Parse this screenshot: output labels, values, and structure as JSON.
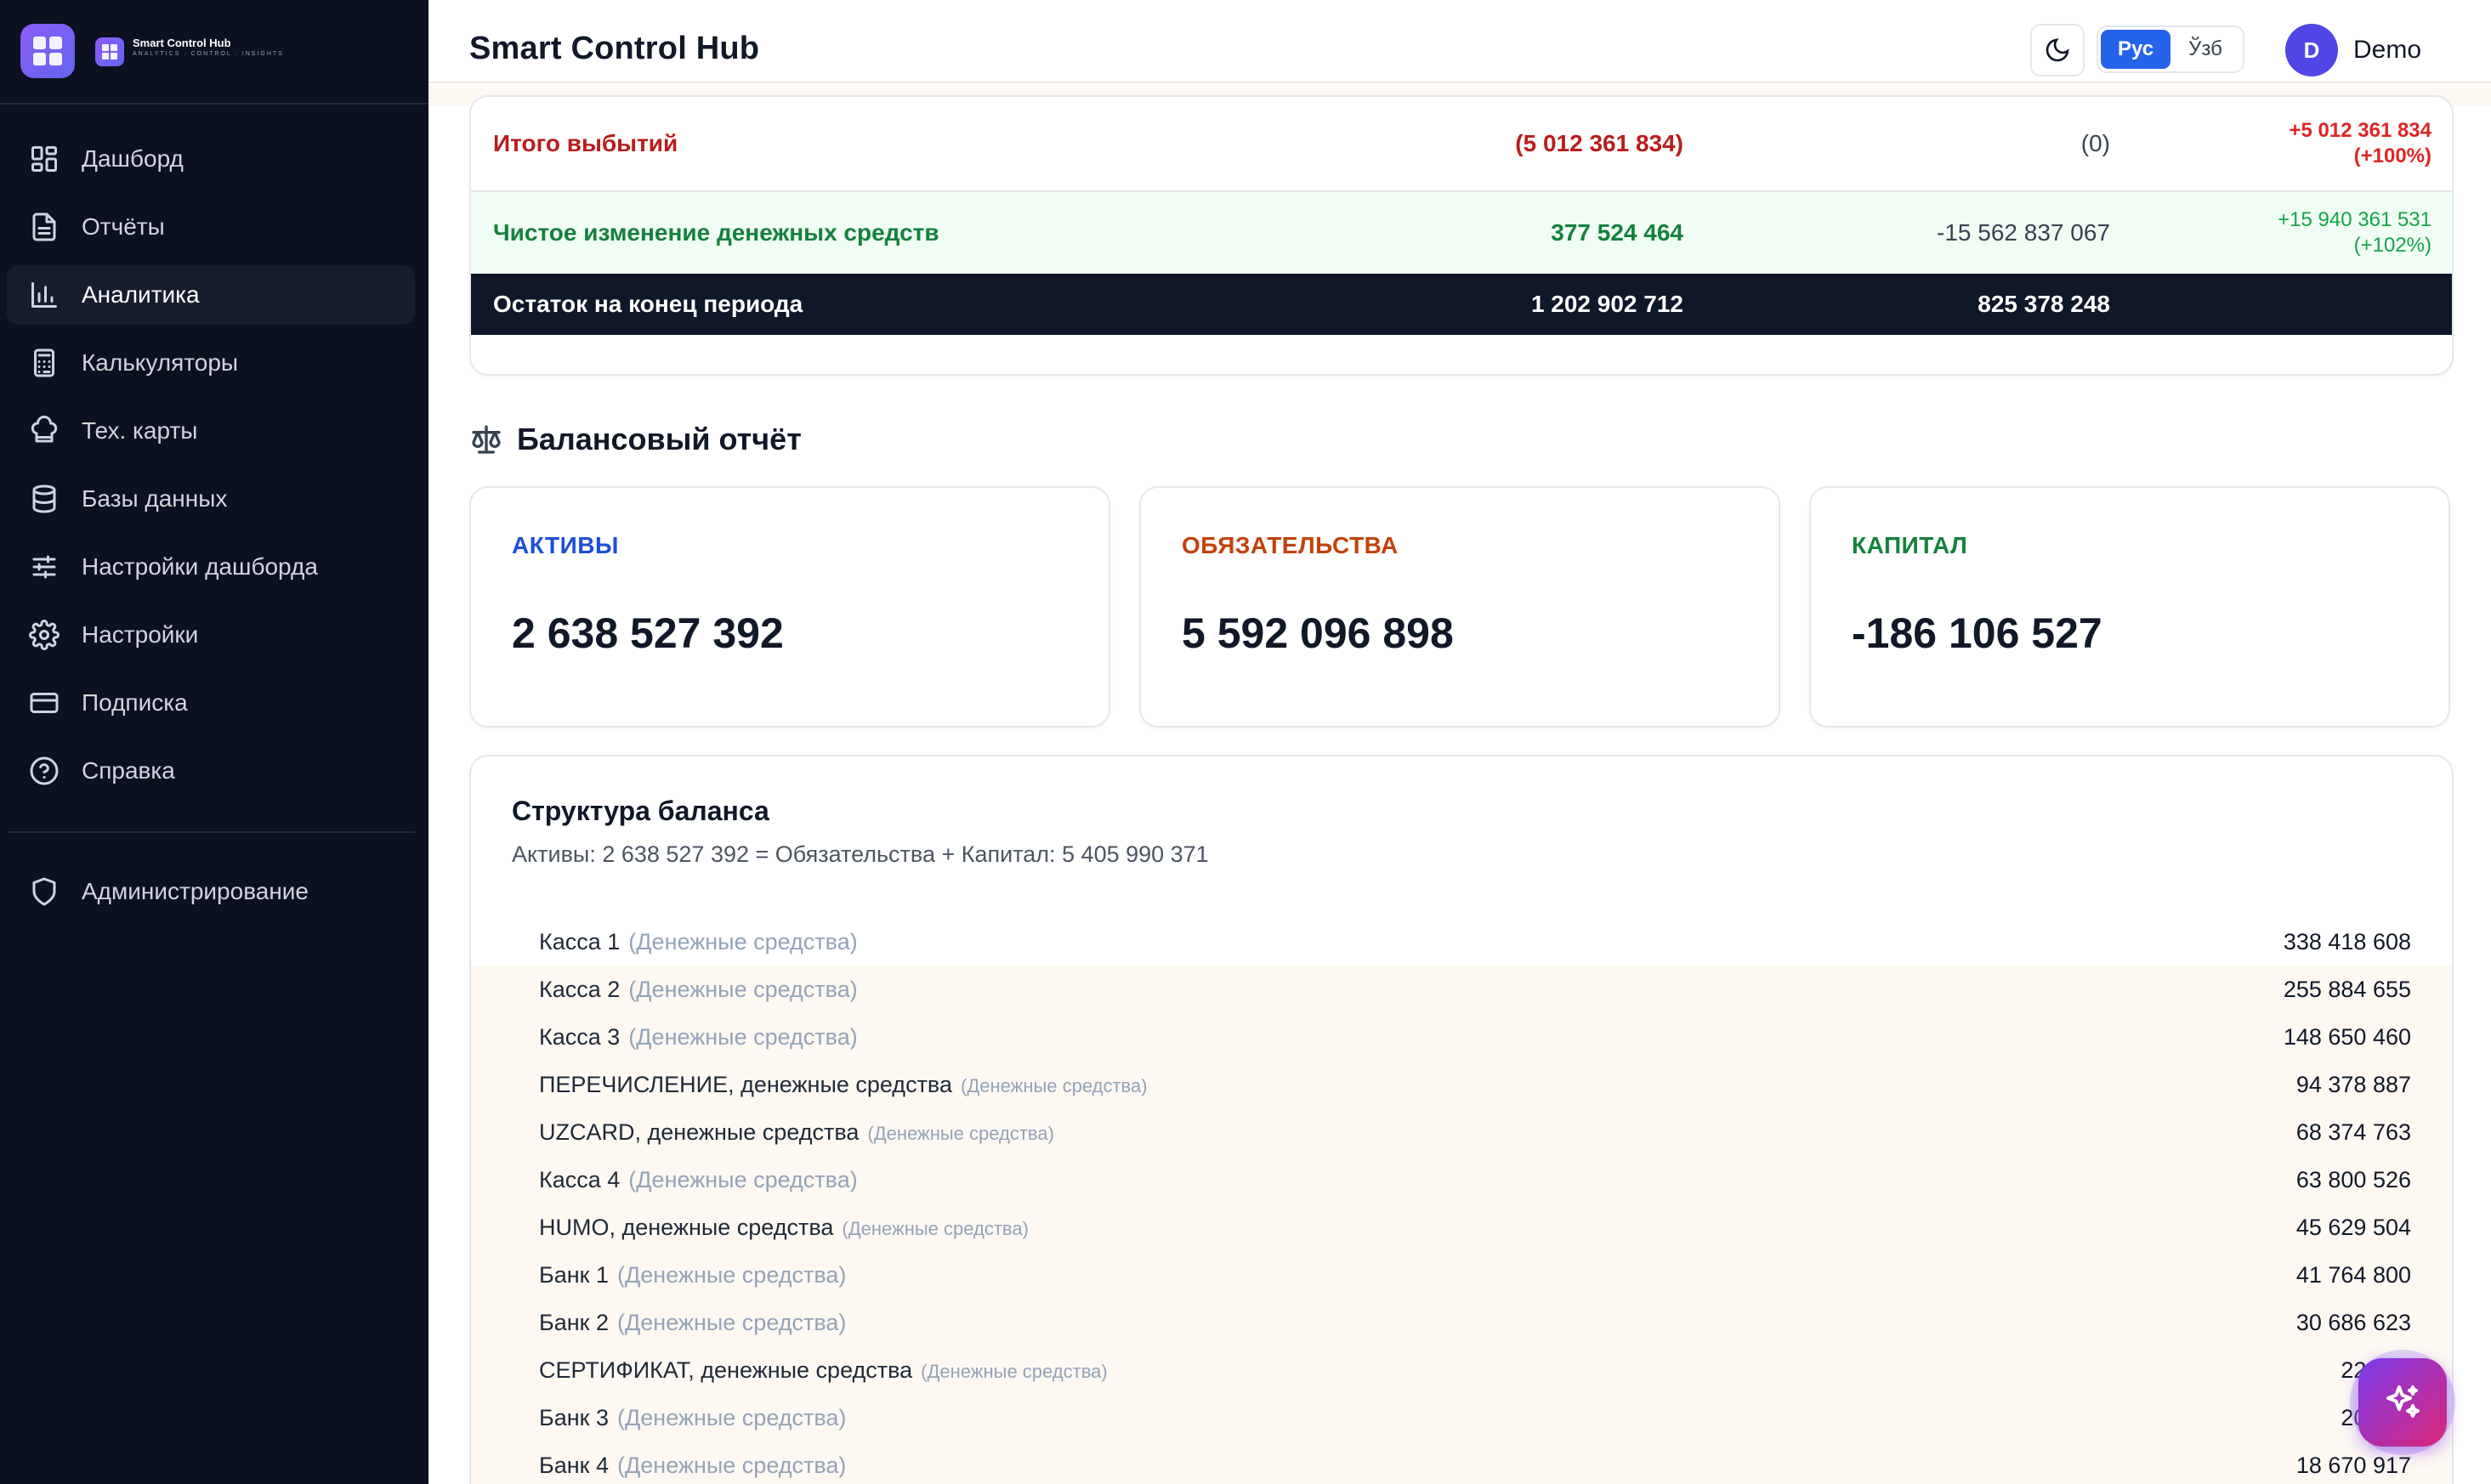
{
  "brand": {
    "name": "Smart Control Hub",
    "tagline": "ANALYTICS · CONTROL · INSIGHTS"
  },
  "sidebar": {
    "items": [
      {
        "label": "Дашборд",
        "icon": "dashboard-icon"
      },
      {
        "label": "Отчёты",
        "icon": "report-icon"
      },
      {
        "label": "Аналитика",
        "icon": "analytics-icon",
        "active": true
      },
      {
        "label": "Калькуляторы",
        "icon": "calculator-icon"
      },
      {
        "label": "Тех. карты",
        "icon": "chef-hat-icon"
      },
      {
        "label": "Базы данных",
        "icon": "database-icon"
      },
      {
        "label": "Настройки дашборда",
        "icon": "sliders-icon"
      },
      {
        "label": "Настройки",
        "icon": "gear-icon"
      },
      {
        "label": "Подписка",
        "icon": "credit-card-icon"
      },
      {
        "label": "Справка",
        "icon": "help-icon"
      }
    ],
    "admin": {
      "label": "Администрирование",
      "icon": "shield-icon"
    }
  },
  "header": {
    "title": "Smart Control Hub",
    "lang_ru": "Рус",
    "lang_uz": "Ўзб",
    "user_initial": "D",
    "user_name": "Demo"
  },
  "cash_flow": {
    "total_out": {
      "label": "Итого выбытий",
      "v1": "(5 012 361 834)",
      "v2": "(0)",
      "delta": "+5 012 361 834",
      "delta_pct": "(+100%)"
    },
    "net_change": {
      "label": "Чистое изменение денежных средств",
      "v1": "377 524 464",
      "v2": "-15 562 837 067",
      "delta": "+15 940 361 531",
      "delta_pct": "(+102%)"
    },
    "end_balance": {
      "label": "Остаток на конец периода",
      "v1": "1 202 902 712",
      "v2": "825 378 248"
    }
  },
  "balance": {
    "section_title": "Балансовый отчёт",
    "assets": {
      "label": "АКТИВЫ",
      "value": "2 638 527 392"
    },
    "liabilities": {
      "label": "ОБЯЗАТЕЛЬСТВА",
      "value": "5 592 096 898"
    },
    "equity": {
      "label": "КАПИТАЛ",
      "value": "-186 106 527"
    }
  },
  "structure": {
    "title": "Структура баланса",
    "subtitle": "Активы: 2 638 527 392 = Обязательства + Капитал: 5 405 990 371",
    "rows": [
      {
        "name": "Касса 1",
        "category": "(Денежные средства)",
        "value": "338 418 608"
      },
      {
        "name": "Касса 2",
        "category": "(Денежные средства)",
        "value": "255 884 655"
      },
      {
        "name": "Касса 3",
        "category": "(Денежные средства)",
        "value": "148 650 460"
      },
      {
        "name": "ПЕРЕЧИСЛЕНИЕ, денежные средства",
        "category": "(Денежные средства)",
        "value": "94 378 887"
      },
      {
        "name": "UZCARD, денежные средства",
        "category": "(Денежные средства)",
        "value": "68 374 763"
      },
      {
        "name": "Касса 4",
        "category": "(Денежные средства)",
        "value": "63 800 526"
      },
      {
        "name": "HUMO, денежные средства",
        "category": "(Денежные средства)",
        "value": "45 629 504"
      },
      {
        "name": "Банк 1",
        "category": "(Денежные средства)",
        "value": "41 764 800"
      },
      {
        "name": "Банк 2",
        "category": "(Денежные средства)",
        "value": "30 686 623"
      },
      {
        "name": "СЕРТИФИКАТ, денежные средства",
        "category": "(Денежные средства)",
        "value": "22 969"
      },
      {
        "name": "Банк 3",
        "category": "(Денежные средства)",
        "value": "20 572"
      },
      {
        "name": "Банк 4",
        "category": "(Денежные средства)",
        "value": "18 670 917"
      }
    ]
  }
}
